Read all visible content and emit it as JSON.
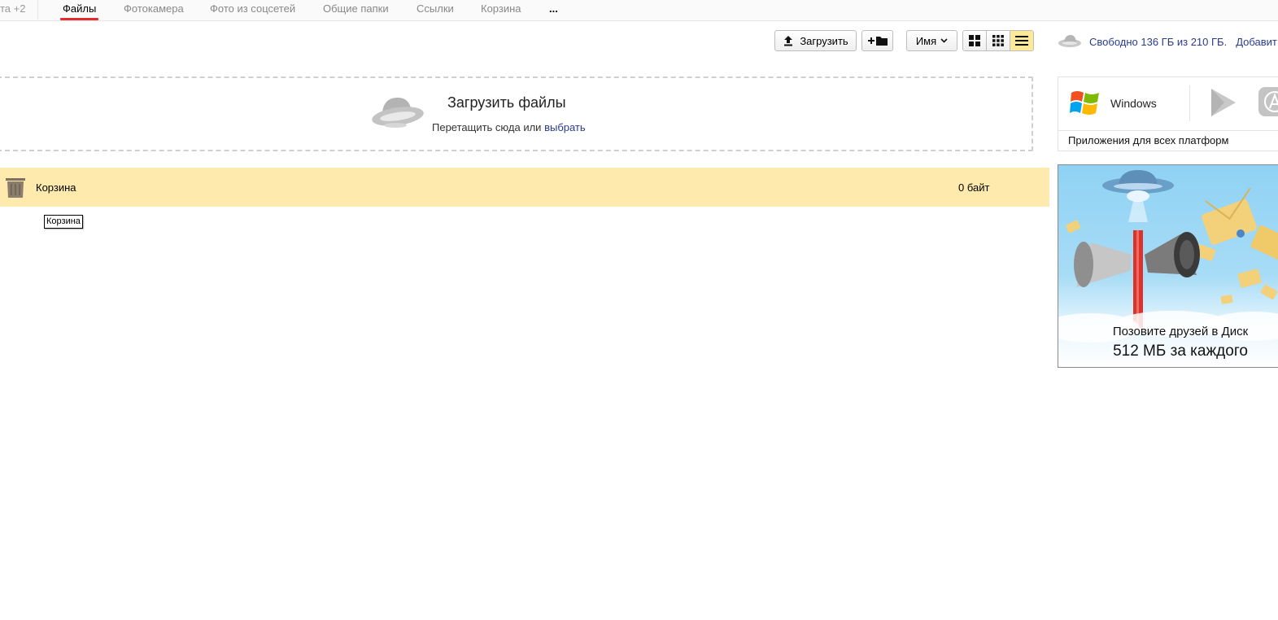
{
  "nav": {
    "prev_fragment": "та +2",
    "tabs": [
      {
        "label": "Файлы"
      },
      {
        "label": "Фотокамера"
      },
      {
        "label": "Фото из соцсетей"
      },
      {
        "label": "Общие папки"
      },
      {
        "label": "Ссылки"
      },
      {
        "label": "Корзина"
      },
      {
        "label": "..."
      }
    ]
  },
  "toolbar": {
    "upload_label": "Загрузить",
    "sort_label": "Имя"
  },
  "storage": {
    "text": "Свободно 136 ГБ из 210 ГБ.",
    "add_label": "Добавит"
  },
  "dropzone": {
    "title": "Загрузить файлы",
    "subtitle": "Перетащить сюда или",
    "link": "выбрать"
  },
  "files": [
    {
      "name": "Корзина",
      "size": "0 байт"
    }
  ],
  "tooltip": "Корзина",
  "apps": {
    "windows_label": "Windows",
    "caption": "Приложения для всех платформ"
  },
  "promo": {
    "line1": "Позовите друзей в Диск",
    "line2": "512 МБ за каждого"
  },
  "colors": {
    "accent": "#e52b2b",
    "link": "#2a3b8f",
    "selected_row": "#feeaad"
  }
}
